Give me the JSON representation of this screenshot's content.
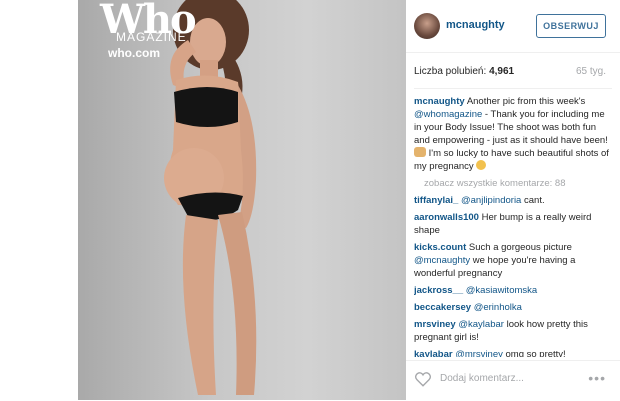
{
  "magazine": {
    "title": "Who",
    "subtitle": "MAGAZINE",
    "url": "who.com"
  },
  "header": {
    "username": "mcnaughty",
    "follow_label": "OBSERWUJ"
  },
  "stats": {
    "likes_label": "Liczba polubień:",
    "likes_count": "4,961",
    "age": "65 tyg."
  },
  "caption": {
    "user": "mcnaughty",
    "text1": "Another pic from this week's",
    "mention": "@whomagazine",
    "text2": "- Thank you for including me in your Body Issue! The shoot was both fun and empowering - just as it should have been!",
    "text3": "I'm so lucky to have such beautiful shots of my pregnancy"
  },
  "view_all": "zobacz wszystkie komentarze: 88",
  "comments": [
    {
      "user": "tiffanylai_",
      "mention": "@anjlipindoria",
      "text": "cant."
    },
    {
      "user": "aaronwalls100",
      "mention": "",
      "text": "Her bump is a really weird shape"
    },
    {
      "user": "kicks.count",
      "mention": "",
      "text": "Such a gorgeous picture",
      "mention2": "@mcnaughty",
      "text2": "we hope you're having a wonderful pregnancy"
    },
    {
      "user": "jackross__",
      "mention": "@kasiawitomska",
      "text": ""
    },
    {
      "user": "beccakersey",
      "mention": "@erinholka",
      "text": ""
    },
    {
      "user": "mrsviney",
      "mention": "@kaylabar",
      "text": "look how pretty this pregnant girl is!"
    },
    {
      "user": "kaylabar",
      "mention": "@mrsviney",
      "text": "omg so pretty!"
    }
  ],
  "footer": {
    "placeholder": "Dodaj komentarz...",
    "more": "•••"
  },
  "icons": {
    "like": "heart-icon",
    "options": "more-options-icon",
    "avatar": "avatar"
  }
}
